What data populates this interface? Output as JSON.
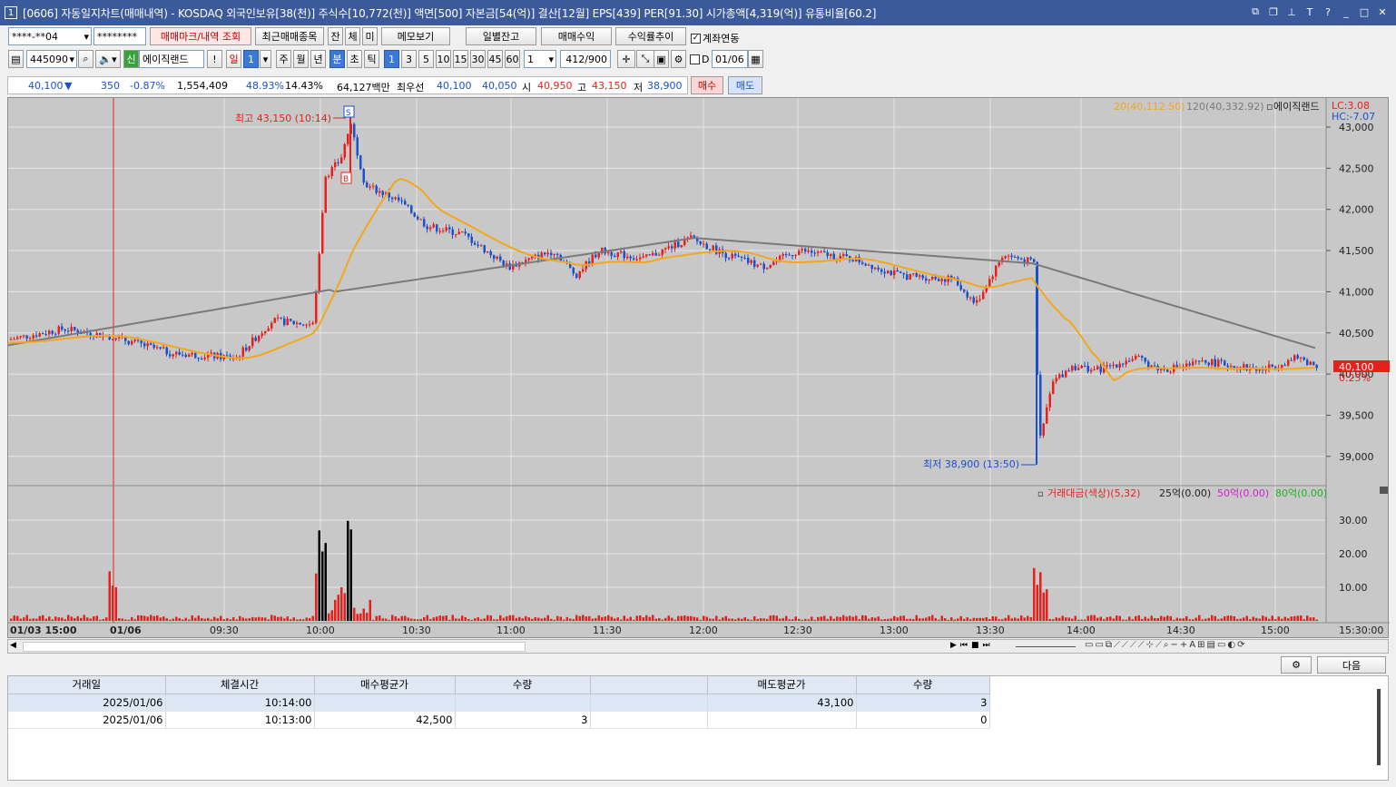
{
  "window": {
    "num": "1",
    "title": "[0606] 자동일지차트(매매내역) - KOSDAQ 외국인보유[38(천)] 주식수[10,772(천)] 액면[500] 자본금[54(억)] 결산[12월] EPS[439] PER[91.30] 시가총액[4,319(억)] 유통비율[60.2]"
  },
  "row1": {
    "account": "****-**04",
    "password": "********",
    "btn_mark": "매매마크/내역 조회",
    "btn_recent": "최근매매종목",
    "t1": "잔",
    "t2": "체",
    "t3": "미",
    "btn_memo": "메모보기",
    "btn_daily": "일별잔고",
    "btn_profit": "매매수익",
    "btn_rate": "수익률추이",
    "chk_link": "계좌연동"
  },
  "row2": {
    "code": "445090",
    "badge": "신",
    "name": "에이직랜드",
    "alert": "!",
    "period": [
      "일",
      "1",
      "주",
      "월",
      "년",
      "분",
      "초",
      "틱"
    ],
    "mins": [
      "1",
      "3",
      "5",
      "10",
      "15",
      "30",
      "45",
      "60"
    ],
    "unit": "1",
    "count": "412",
    "total": "/900",
    "chk_d": "D",
    "date": "01/06"
  },
  "quote": {
    "price": "40,100",
    "arrow": "▼",
    "change": "350",
    "pct": "-0.87%",
    "volume": "1,554,409",
    "r1": "48.93%",
    "r2": "14.43%",
    "amount": "64,127백만",
    "best_lbl": "최우선",
    "best_ask": "40,100",
    "best_bid": "40,050",
    "open_lbl": "시",
    "open": "40,950",
    "high_lbl": "고",
    "high": "43,150",
    "low_lbl": "저",
    "low": "38,900",
    "buy": "매수",
    "sell": "매도"
  },
  "chart": {
    "legend": {
      "ma20": "20(40,112.50)",
      "ma120": "120(40,332.92)",
      "name": "에이직랜드"
    },
    "lc": "LC:3.08",
    "hc": "HC:-7.07",
    "price_ticks": [
      "43,000",
      "42,500",
      "42,000",
      "41,500",
      "41,000",
      "40,500",
      "40,000",
      "39,500",
      "39,000"
    ],
    "last_price": "40,100",
    "last_pct": "0.25%",
    "max_label": "최고 43,150 (10:14)",
    "min_label": "최저 38,900 (13:50)",
    "mark_s": "S",
    "mark_b": "B",
    "vol_legend": {
      "main": "거래대금(색상)(5,32)",
      "l25": "25억(0.00)",
      "l50": "50억(0.00)",
      "l80": "80억(0.00)"
    },
    "vol_ticks": [
      "30.00",
      "20.00",
      "10.00"
    ],
    "time_labels": [
      "01/03 15:00",
      "01/06",
      "09:30",
      "10:00",
      "10:30",
      "11:00",
      "11:30",
      "12:00",
      "12:30",
      "13:00",
      "13:30",
      "14:00",
      "14:30",
      "15:00",
      "15:30:00"
    ],
    "colors": {
      "up": "#e8201c",
      "down": "#1a4fcf",
      "ma20": "#f2a81c",
      "ma120": "#7a7a7a"
    }
  },
  "chart_data": {
    "type": "candlestick",
    "title": "",
    "xlabel": "",
    "ylabel": "",
    "ylim": [
      38800,
      43250
    ],
    "open": 40950,
    "high": 43150,
    "low": 38900,
    "close": 40100,
    "high_time": "10:14",
    "low_time": "13:50"
  },
  "grid": {
    "headers": [
      "거래일",
      "체결시간",
      "매수평균가",
      "수량",
      "",
      "매도평균가",
      "수량"
    ],
    "rows": [
      [
        "2025/01/06",
        "10:14:00",
        "",
        "",
        "",
        "43,100",
        "3"
      ],
      [
        "2025/01/06",
        "10:13:00",
        "42,500",
        "3",
        "",
        "",
        "0"
      ]
    ],
    "next": "다음"
  }
}
